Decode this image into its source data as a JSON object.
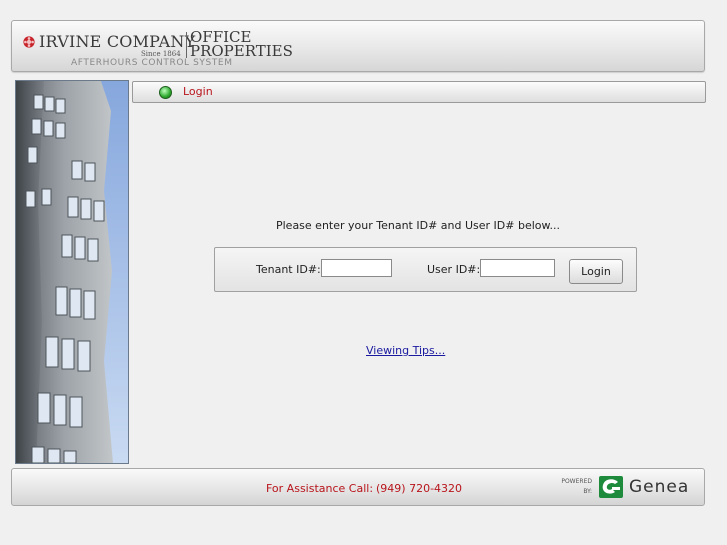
{
  "header": {
    "company_name": "IRVINE COMPANY",
    "since": "Since 1864",
    "division_line1": "OFFICE",
    "division_line2": "PROPERTIES",
    "system_name": "AFTERHOURS CONTROL SYSTEM"
  },
  "nav": {
    "label": "Login",
    "status_color": "#2ea92e"
  },
  "main": {
    "instructions": "Please enter your Tenant ID# and User ID# below...",
    "tenant_label": "Tenant ID#:",
    "tenant_value": "",
    "user_label": "User ID#:",
    "user_value": "",
    "login_button": "Login",
    "tips_link": "Viewing Tips..."
  },
  "footer": {
    "assist_label": "For Assistance Call:",
    "assist_phone": "(949) 720-4320",
    "powered_line1": "POWERED",
    "powered_line2": "BY:",
    "brand": "Genea"
  },
  "colors": {
    "accent_red": "#b8151c",
    "link_blue": "#1a1aa0",
    "brand_green": "#1e8a3c"
  }
}
